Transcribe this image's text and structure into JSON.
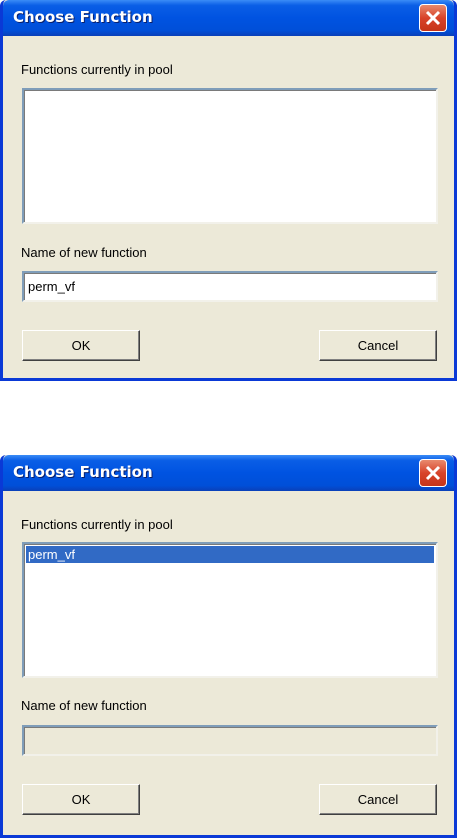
{
  "dialogs": [
    {
      "title": "Choose Function",
      "pool_label": "Functions currently in pool",
      "pool_items": [],
      "name_label": "Name of new function",
      "name_value": "perm_vf",
      "name_enabled": true,
      "ok_label": "OK",
      "cancel_label": "Cancel"
    },
    {
      "title": "Choose Function",
      "pool_label": "Functions currently in pool",
      "pool_items": [
        "perm_vf"
      ],
      "selected_item": "perm_vf",
      "name_label": "Name of new function",
      "name_value": "",
      "name_enabled": false,
      "ok_label": "OK",
      "cancel_label": "Cancel"
    }
  ],
  "colors": {
    "titlebar": "#0053e1",
    "dialog_bg": "#ece9d8",
    "selection": "#316ac5",
    "close_button": "#d8432a"
  }
}
